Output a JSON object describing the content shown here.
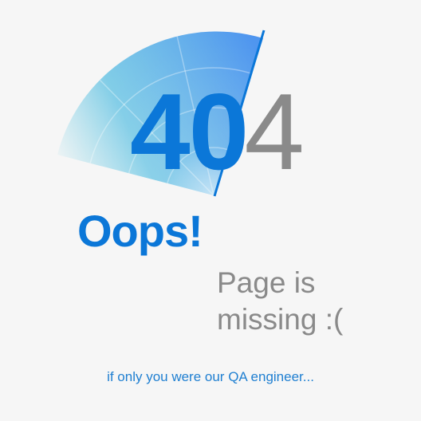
{
  "error": {
    "code_left": "40",
    "code_right": "4"
  },
  "headline": "Oops!",
  "message": {
    "line1": "Page is",
    "line2": "missing :("
  },
  "tagline": "if only you were our QA engineer...",
  "colors": {
    "accent": "#0b77d8",
    "muted": "#8a8a8a",
    "background": "#f6f6f6"
  }
}
